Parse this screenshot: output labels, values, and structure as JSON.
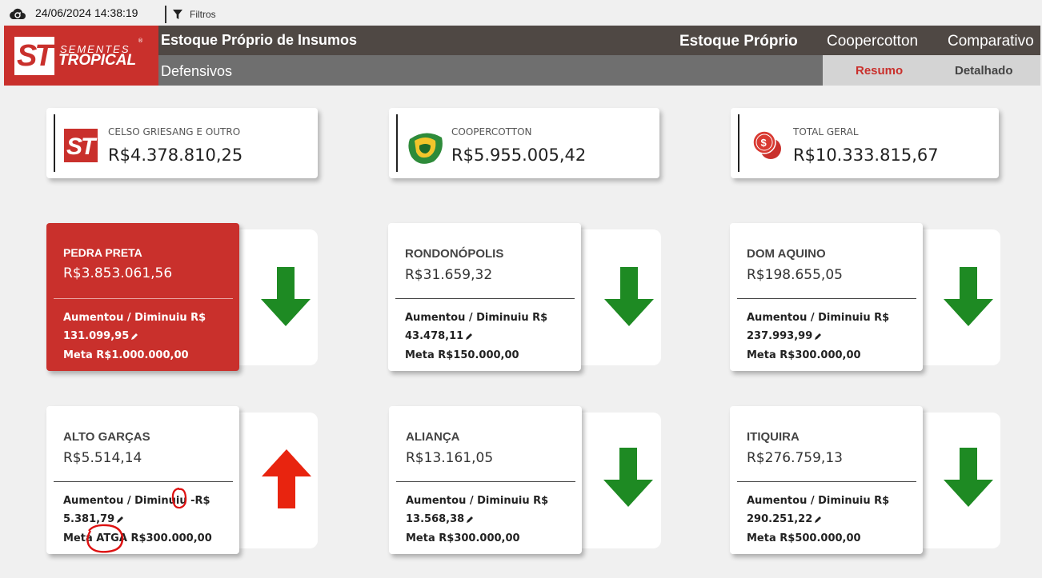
{
  "topbar": {
    "datetime": "24/06/2024 14:38:19",
    "filter_label": "Filtros"
  },
  "logo": {
    "mark": "ST",
    "line1": "SEMENTES",
    "line2": "TROPICAL",
    "registered": "®"
  },
  "header": {
    "title": "Estoque Próprio de Insumos",
    "subtitle": "Defensivos",
    "nav": [
      {
        "label": "Estoque Próprio",
        "active": true
      },
      {
        "label": "Coopercotton",
        "active": false
      },
      {
        "label": "Comparativo",
        "active": false
      }
    ],
    "subtabs": [
      {
        "label": "Resumo",
        "active": true
      },
      {
        "label": "Detalhado",
        "active": false
      }
    ]
  },
  "summary": [
    {
      "label": "CELSO GRIESANG E OUTRO",
      "value": "R$4.378.810,25",
      "icon": "st-logo-icon"
    },
    {
      "label": "COOPERCOTTON",
      "value": "R$5.955.005,42",
      "icon": "coopercotton-logo-icon"
    },
    {
      "label": "TOTAL GERAL",
      "value": "R$10.333.815,67",
      "icon": "money-coins-icon"
    }
  ],
  "cards": [
    {
      "name": "PEDRA PRETA",
      "value": "R$3.853.061,56",
      "change_label": "Aumentou / Diminuiu R$",
      "change_value": "131.099,95",
      "meta": "Meta R$1.000.000,00",
      "trend": "down"
    },
    {
      "name": "RONDONÓPOLIS",
      "value": "R$31.659,32",
      "change_label": "Aumentou / Diminuiu R$",
      "change_value": "43.478,11",
      "meta": "Meta R$150.000,00",
      "trend": "down"
    },
    {
      "name": "DOM AQUINO",
      "value": "R$198.655,05",
      "change_label": "Aumentou / Diminuiu R$",
      "change_value": "237.993,99",
      "meta": "Meta R$300.000,00",
      "trend": "down"
    },
    {
      "name": "ALTO GARÇAS",
      "value": "R$5.514,14",
      "change_label": "Aumentou / Diminuiu -R$",
      "change_value": "5.381,79",
      "meta": "Meta ATGA R$300.000,00",
      "trend": "up"
    },
    {
      "name": "ALIANÇA",
      "value": "R$13.161,05",
      "change_label": "Aumentou / Diminuiu R$",
      "change_value": "13.568,38",
      "meta": "Meta R$300.000,00",
      "trend": "down"
    },
    {
      "name": "ITIQUIRA",
      "value": "R$276.759,13",
      "change_label": "Aumentou / Diminuiu R$",
      "change_value": "290.251,22",
      "meta": "Meta R$500.000,00",
      "trend": "down"
    }
  ],
  "colors": {
    "brand_red": "#c9302c",
    "header_dark": "#4f4844",
    "header_grey": "#6f6f6f",
    "arrow_down": "#1e8a23",
    "arrow_up": "#e8240f",
    "annotation": "#d11"
  }
}
